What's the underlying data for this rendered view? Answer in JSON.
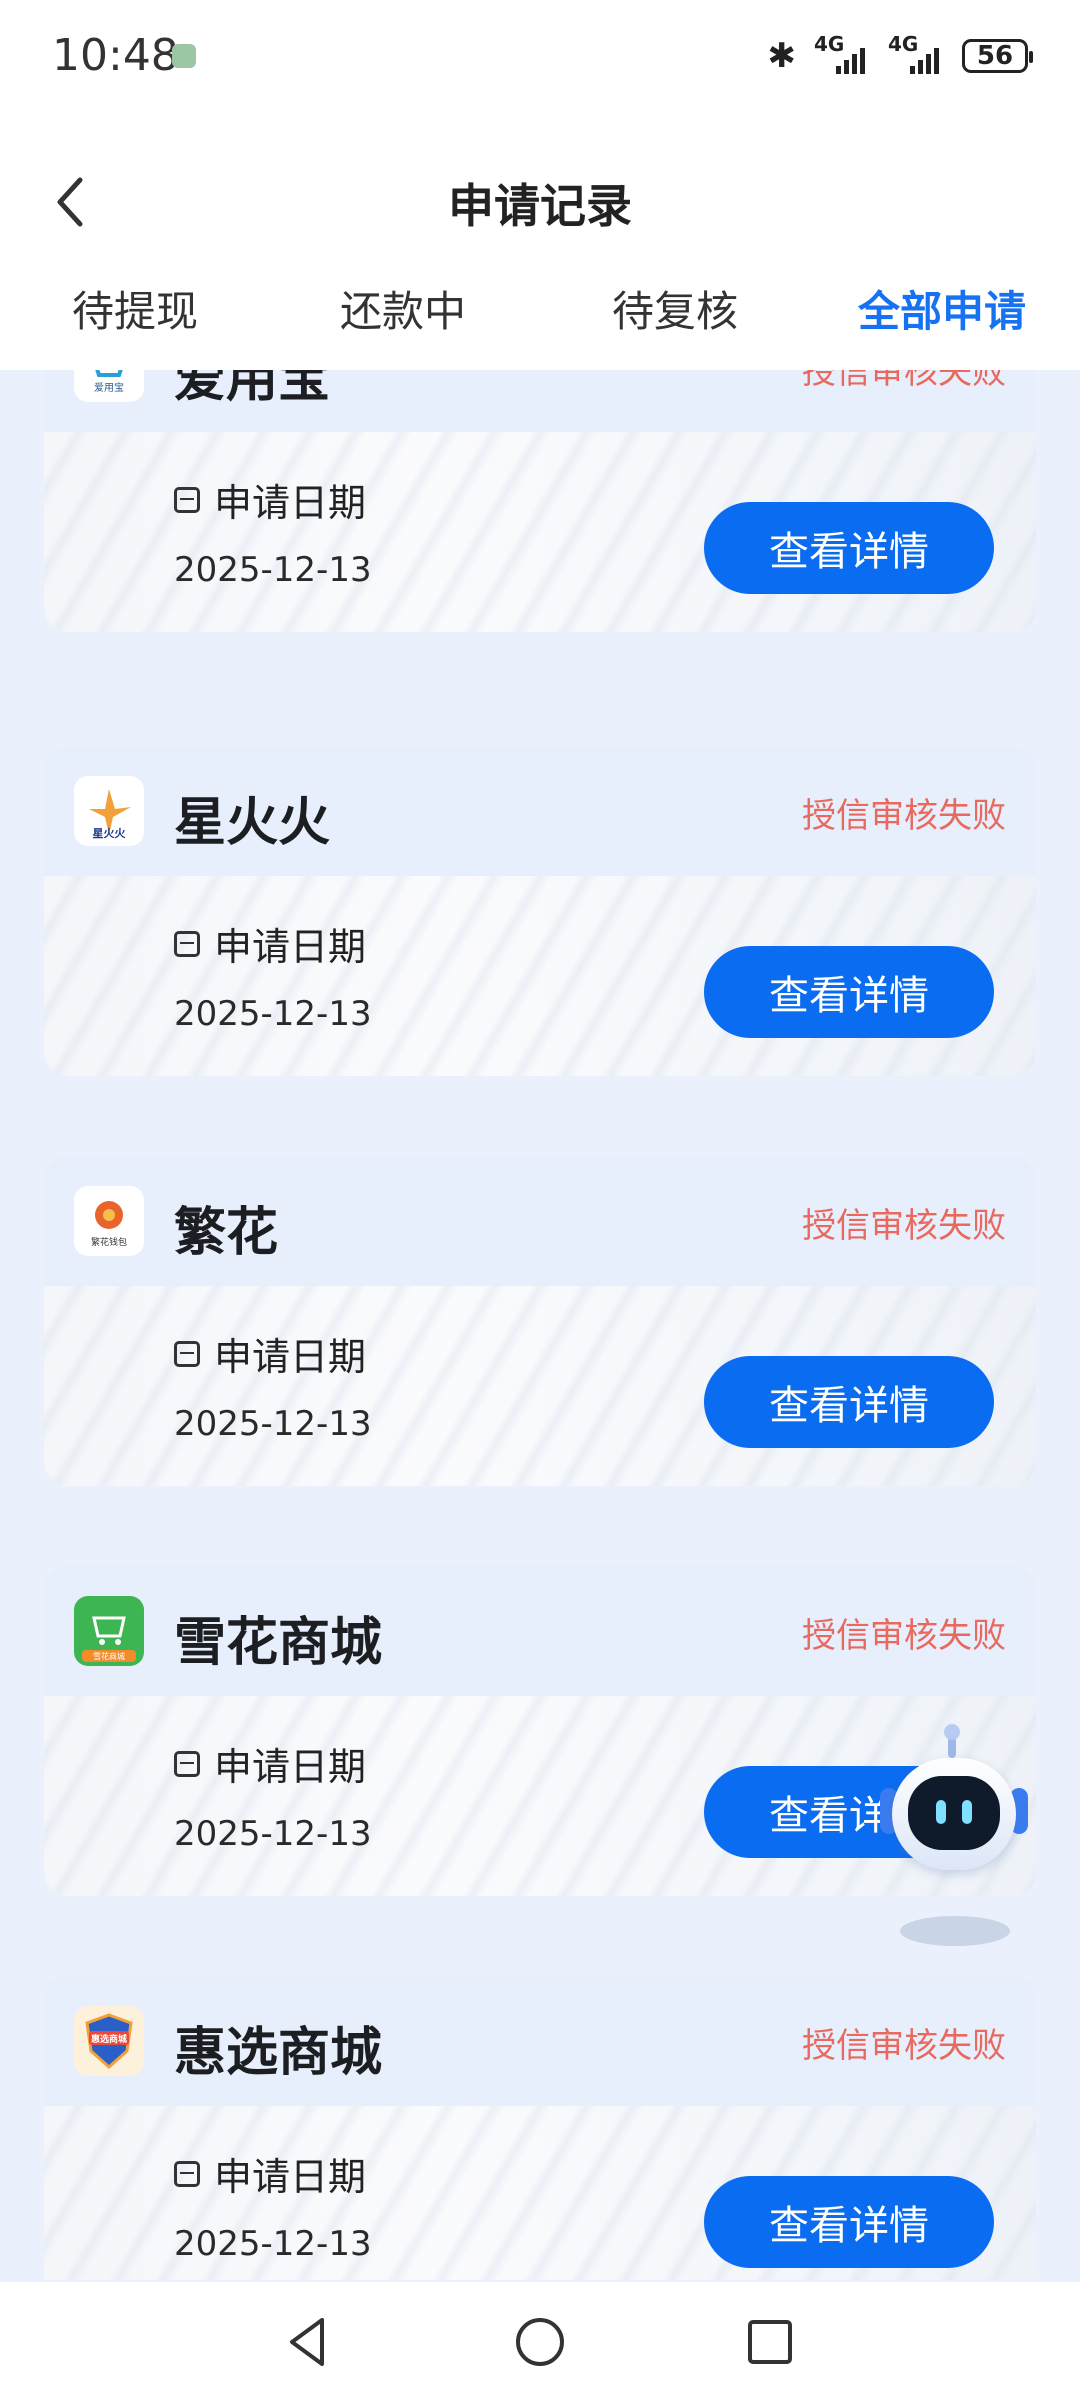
{
  "status_bar": {
    "time": "10:48",
    "battery": "56",
    "signal1": "4G",
    "signal2": "4G"
  },
  "header": {
    "title": "申请记录"
  },
  "tabs": [
    {
      "label": "待提现",
      "active": false
    },
    {
      "label": "还款中",
      "active": false
    },
    {
      "label": "待复核",
      "active": false
    },
    {
      "label": "全部申请",
      "active": true
    }
  ],
  "records": [
    {
      "name": "爱用宝",
      "status": "授信审核失败",
      "date_label": "申请日期",
      "date": "2025-12-13",
      "button": "查看详情"
    },
    {
      "name": "星火火",
      "status": "授信审核失败",
      "date_label": "申请日期",
      "date": "2025-12-13",
      "button": "查看详情"
    },
    {
      "name": "繁花",
      "status": "授信审核失败",
      "date_label": "申请日期",
      "date": "2025-12-13",
      "button": "查看详情"
    },
    {
      "name": "雪花商城",
      "status": "授信审核失败",
      "date_label": "申请日期",
      "date": "2025-12-13",
      "button": "查看详情"
    },
    {
      "name": "惠选商城",
      "status": "授信审核失败",
      "date_label": "申请日期",
      "date": "2025-12-13",
      "button": "查看详情"
    }
  ],
  "colors": {
    "accent": "#1672f2",
    "button": "#0a6cf0",
    "status_fail": "#e86a5f"
  }
}
